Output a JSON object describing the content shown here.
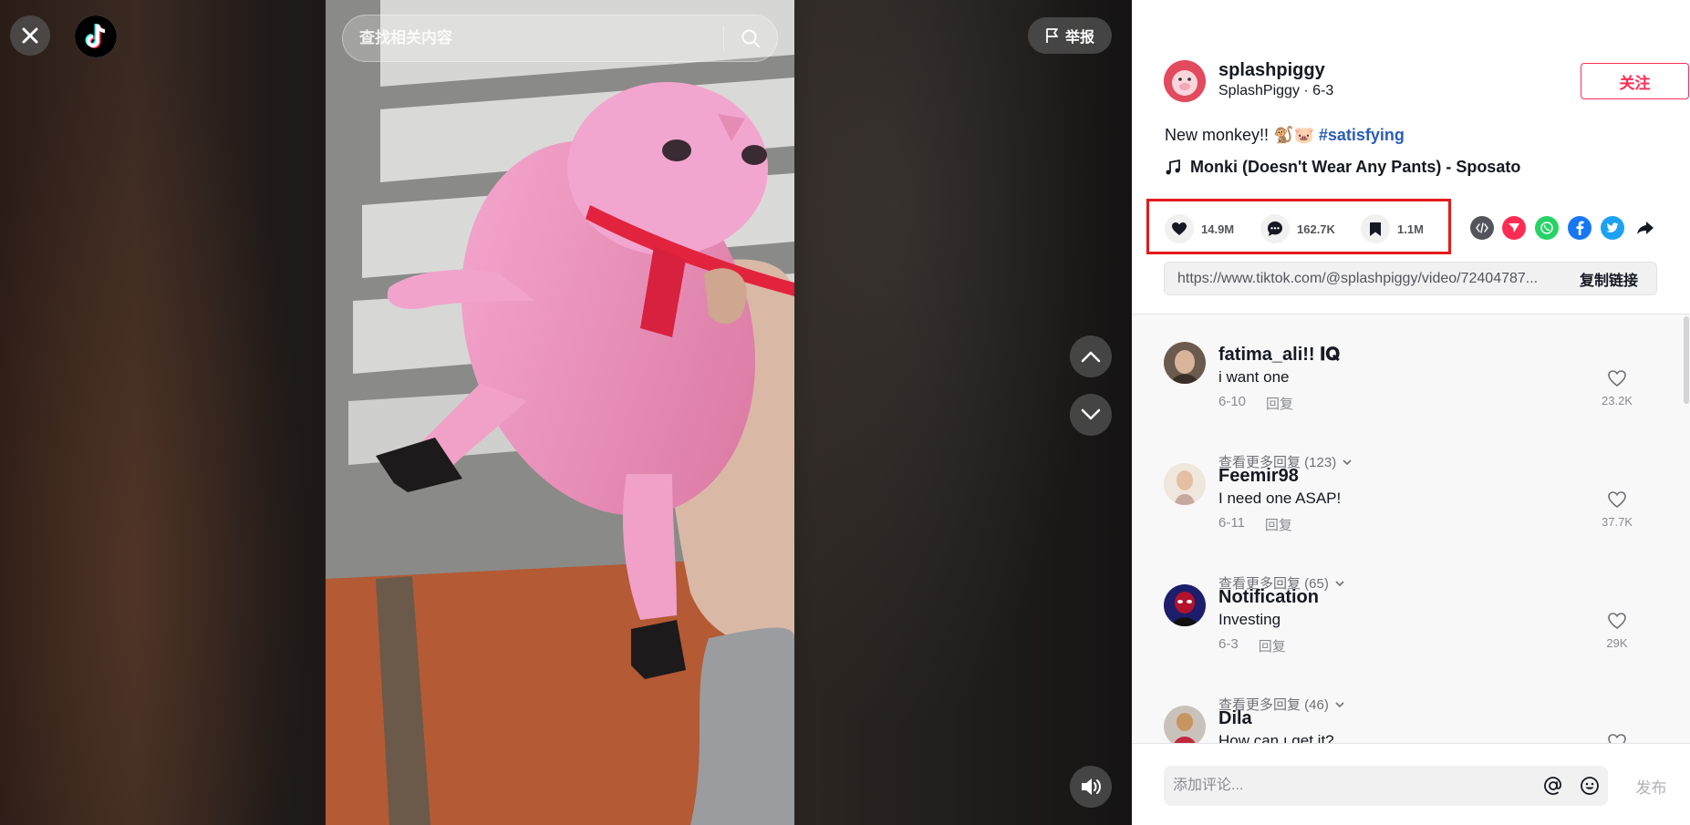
{
  "search": {
    "placeholder": "查找相关内容"
  },
  "header": {
    "report_label": "举报"
  },
  "author": {
    "username": "splashpiggy",
    "nickname_date": "SplashPiggy · 6-3",
    "follow_label": "关注"
  },
  "post": {
    "caption_text": "New monkey!! 🐒🐷 ",
    "caption_hashtag": "#satisfying",
    "music": "Monki (Doesn't Wear Any Pants) - Sposato"
  },
  "actions": {
    "likes": "14.9M",
    "comments": "162.7K",
    "saves": "1.1M"
  },
  "share": {
    "icons": [
      "embed-icon",
      "send-icon",
      "whatsapp-icon",
      "facebook-icon",
      "twitter-icon",
      "share-arrow-icon"
    ],
    "link_url": "https://www.tiktok.com/@splashpiggy/video/72404787...",
    "copy_label": "复制链接"
  },
  "comments": [
    {
      "user": "fatima_ali!! 𝐈𝐐",
      "text": "i want one",
      "date": "6-10",
      "reply_label": "回复",
      "likes": "23.2K",
      "more": "查看更多回复 (123)"
    },
    {
      "user": "Feemir98",
      "text": "I need one ASAP!",
      "date": "6-11",
      "reply_label": "回复",
      "likes": "37.7K",
      "more": "查看更多回复 (65)"
    },
    {
      "user": "Notification",
      "text": "Investing",
      "date": "6-3",
      "reply_label": "回复",
      "likes": "29K",
      "more": "查看更多回复 (46)"
    },
    {
      "user": "Dila",
      "text": "How can ı get it?"
    }
  ],
  "comment_input": {
    "placeholder": "添加评论...",
    "post_label": "发布"
  },
  "colors": {
    "accent": "#fe2c55",
    "highlight_box": "#e41a1a",
    "hashtag": "#2b5db9"
  }
}
